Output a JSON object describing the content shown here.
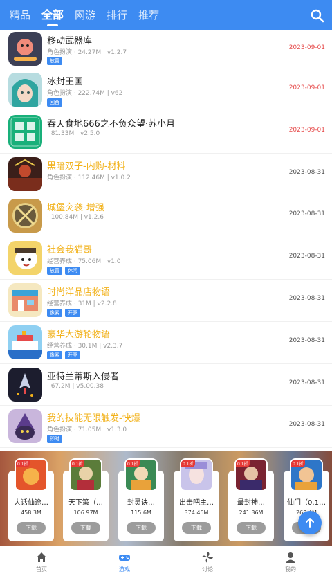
{
  "topbar": {
    "tabs": [
      "精品",
      "全部",
      "网游",
      "排行",
      "推荐"
    ],
    "active_tab": "全部"
  },
  "games": [
    {
      "title": "移动武器库",
      "meta": "角色扮演 · 24.27M | v1.2.7",
      "tags": [
        "放置"
      ],
      "date": "2023-09-01",
      "date_color": "red",
      "title_color": "dark"
    },
    {
      "title": "冰封王国",
      "meta": "角色扮演 · 222.74M | v62",
      "tags": [
        "回合"
      ],
      "date": "2023-09-01",
      "date_color": "red",
      "title_color": "dark"
    },
    {
      "title": "吞天食地666之不负众望·苏小月",
      "meta": "· 81.33M | v2.5.0",
      "tags": [],
      "date": "2023-09-01",
      "date_color": "red",
      "title_color": "dark"
    },
    {
      "title": "黑暗双子-内购-材料",
      "meta": "角色扮演 · 112.46M | v1.0.2",
      "tags": [],
      "date": "2023-08-31",
      "date_color": "dark",
      "title_color": "gold"
    },
    {
      "title": "城堡突袭-增强",
      "meta": "· 100.84M | v1.2.6",
      "tags": [],
      "date": "2023-08-31",
      "date_color": "dark",
      "title_color": "gold"
    },
    {
      "title": "社会我猫哥",
      "meta": "经营养成 · 75.06M | v1.0",
      "tags": [
        "放置",
        "休闲"
      ],
      "date": "2023-08-31",
      "date_color": "dark",
      "title_color": "gold"
    },
    {
      "title": "时尚洋品店物语",
      "meta": "经营养成 · 31M | v2.2.8",
      "tags": [
        "像素",
        "开罗"
      ],
      "date": "2023-08-31",
      "date_color": "dark",
      "title_color": "gold"
    },
    {
      "title": "豪华大游轮物语",
      "meta": "经营养成 · 30.1M | v2.3.7",
      "tags": [
        "像素",
        "开罗"
      ],
      "date": "2023-08-31",
      "date_color": "dark",
      "title_color": "gold"
    },
    {
      "title": "亚特兰蒂斯入侵者",
      "meta": "· 67.2M | v5.00.38",
      "tags": [],
      "date": "2023-08-31",
      "date_color": "dark",
      "title_color": "dark"
    },
    {
      "title": "我的技能无限触发-快爆",
      "meta": "角色扮演 · 71.05M | v1.3.0",
      "tags": [
        "即时"
      ],
      "date": "2023-08-31",
      "date_color": "dark",
      "title_color": "gold"
    }
  ],
  "banner_cards": [
    {
      "name": "大话仙途…",
      "size": "458.3M",
      "badge": "0.1折",
      "button": "下载"
    },
    {
      "name": "天下策（…",
      "size": "106.97M",
      "badge": "0.1折",
      "button": "下载"
    },
    {
      "name": "封灵诀…",
      "size": "115.6M",
      "badge": "0.1折",
      "button": "下载"
    },
    {
      "name": "出击吧主…",
      "size": "374.45M",
      "badge": "0.1折",
      "button": "下载"
    },
    {
      "name": "最封神…",
      "size": "241.36M",
      "badge": "0.1折",
      "button": "下载"
    },
    {
      "name": "仙门（0.1…",
      "size": "268.4M",
      "badge": "0.1折",
      "button": "下载"
    }
  ],
  "bottom_nav": [
    {
      "label": "首页",
      "icon": "home-icon",
      "active": false
    },
    {
      "label": "游戏",
      "icon": "gamepad-icon",
      "active": true
    },
    {
      "label": "讨论",
      "icon": "pinwheel-icon",
      "active": false
    },
    {
      "label": "我的",
      "icon": "user-icon",
      "active": false
    }
  ],
  "colors": {
    "accent": "#3d8bf2",
    "date_red": "#e64a4a",
    "title_gold": "#f2b21b"
  }
}
